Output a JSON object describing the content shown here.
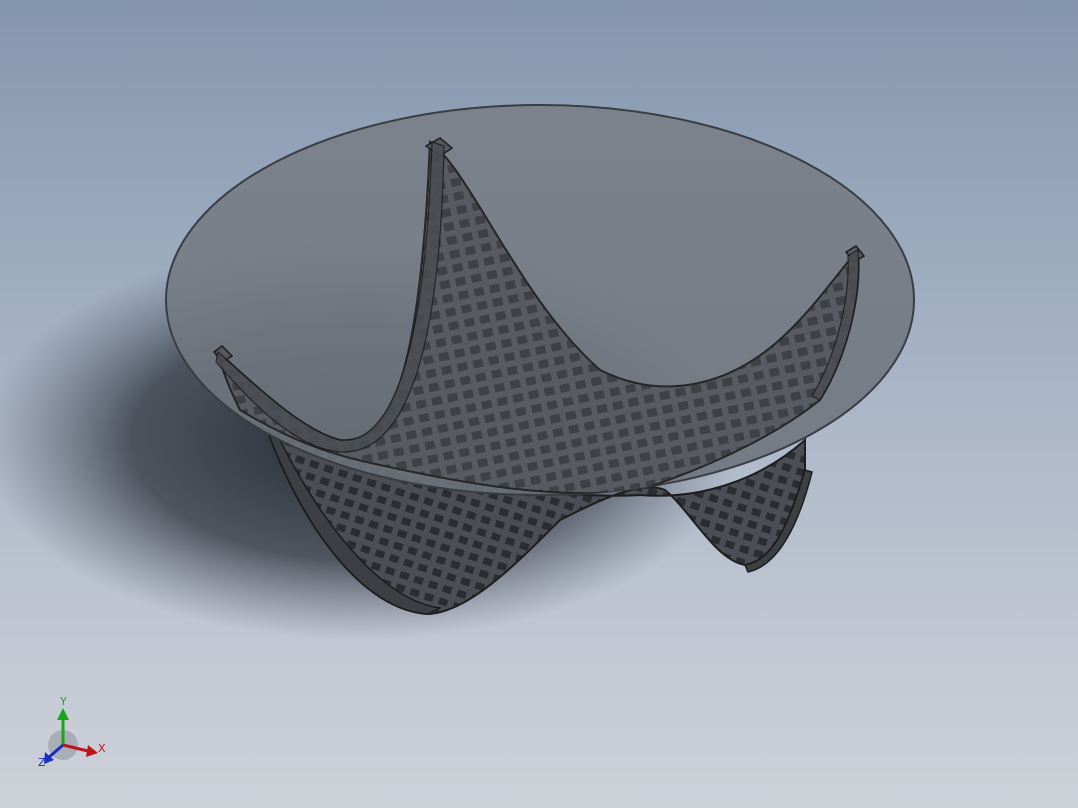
{
  "viewport": {
    "background_top": "#8496ae",
    "background_bottom": "#cdd1d8",
    "model": {
      "name": "lattice-saddle-coffee-table",
      "glass_color": "#7d838b",
      "frame_color": "#3a3a3a",
      "lattice_color": "#2b2b2b",
      "shadow_color": "#2a2f36"
    }
  },
  "triad": {
    "x_label": "X",
    "y_label": "Y",
    "z_label": "Z",
    "x_color": "#c0141c",
    "y_color": "#1aa51a",
    "z_color": "#1c2fc4"
  }
}
